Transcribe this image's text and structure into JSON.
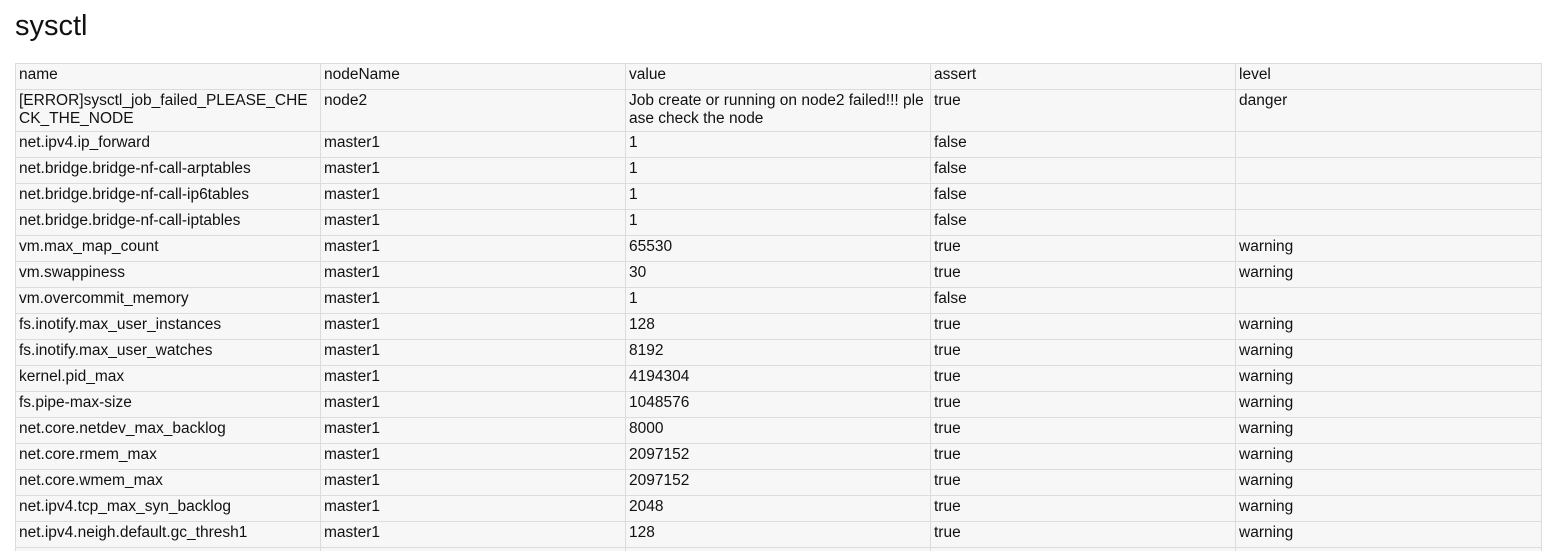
{
  "title": "sysctl",
  "table": {
    "columns": [
      "name",
      "nodeName",
      "value",
      "assert",
      "level"
    ],
    "rows": [
      [
        "[ERROR]sysctl_job_failed_PLEASE_CHECK_THE_NODE",
        "node2",
        "Job create or running on node2 failed!!! please check the node",
        "true",
        "danger"
      ],
      [
        "net.ipv4.ip_forward",
        "master1",
        "1",
        "false",
        ""
      ],
      [
        "net.bridge.bridge-nf-call-arptables",
        "master1",
        "1",
        "false",
        ""
      ],
      [
        "net.bridge.bridge-nf-call-ip6tables",
        "master1",
        "1",
        "false",
        ""
      ],
      [
        "net.bridge.bridge-nf-call-iptables",
        "master1",
        "1",
        "false",
        ""
      ],
      [
        "vm.max_map_count",
        "master1",
        "65530",
        "true",
        "warning"
      ],
      [
        "vm.swappiness",
        "master1",
        "30",
        "true",
        "warning"
      ],
      [
        "vm.overcommit_memory",
        "master1",
        "1",
        "false",
        ""
      ],
      [
        "fs.inotify.max_user_instances",
        "master1",
        "128",
        "true",
        "warning"
      ],
      [
        "fs.inotify.max_user_watches",
        "master1",
        "8192",
        "true",
        "warning"
      ],
      [
        "kernel.pid_max",
        "master1",
        "4194304",
        "true",
        "warning"
      ],
      [
        "fs.pipe-max-size",
        "master1",
        "1048576",
        "true",
        "warning"
      ],
      [
        "net.core.netdev_max_backlog",
        "master1",
        "8000",
        "true",
        "warning"
      ],
      [
        "net.core.rmem_max",
        "master1",
        "2097152",
        "true",
        "warning"
      ],
      [
        "net.core.wmem_max",
        "master1",
        "2097152",
        "true",
        "warning"
      ],
      [
        "net.ipv4.tcp_max_syn_backlog",
        "master1",
        "2048",
        "true",
        "warning"
      ],
      [
        "net.ipv4.neigh.default.gc_thresh1",
        "master1",
        "128",
        "true",
        "warning"
      ],
      [
        "",
        "",
        "",
        "",
        ""
      ]
    ]
  }
}
